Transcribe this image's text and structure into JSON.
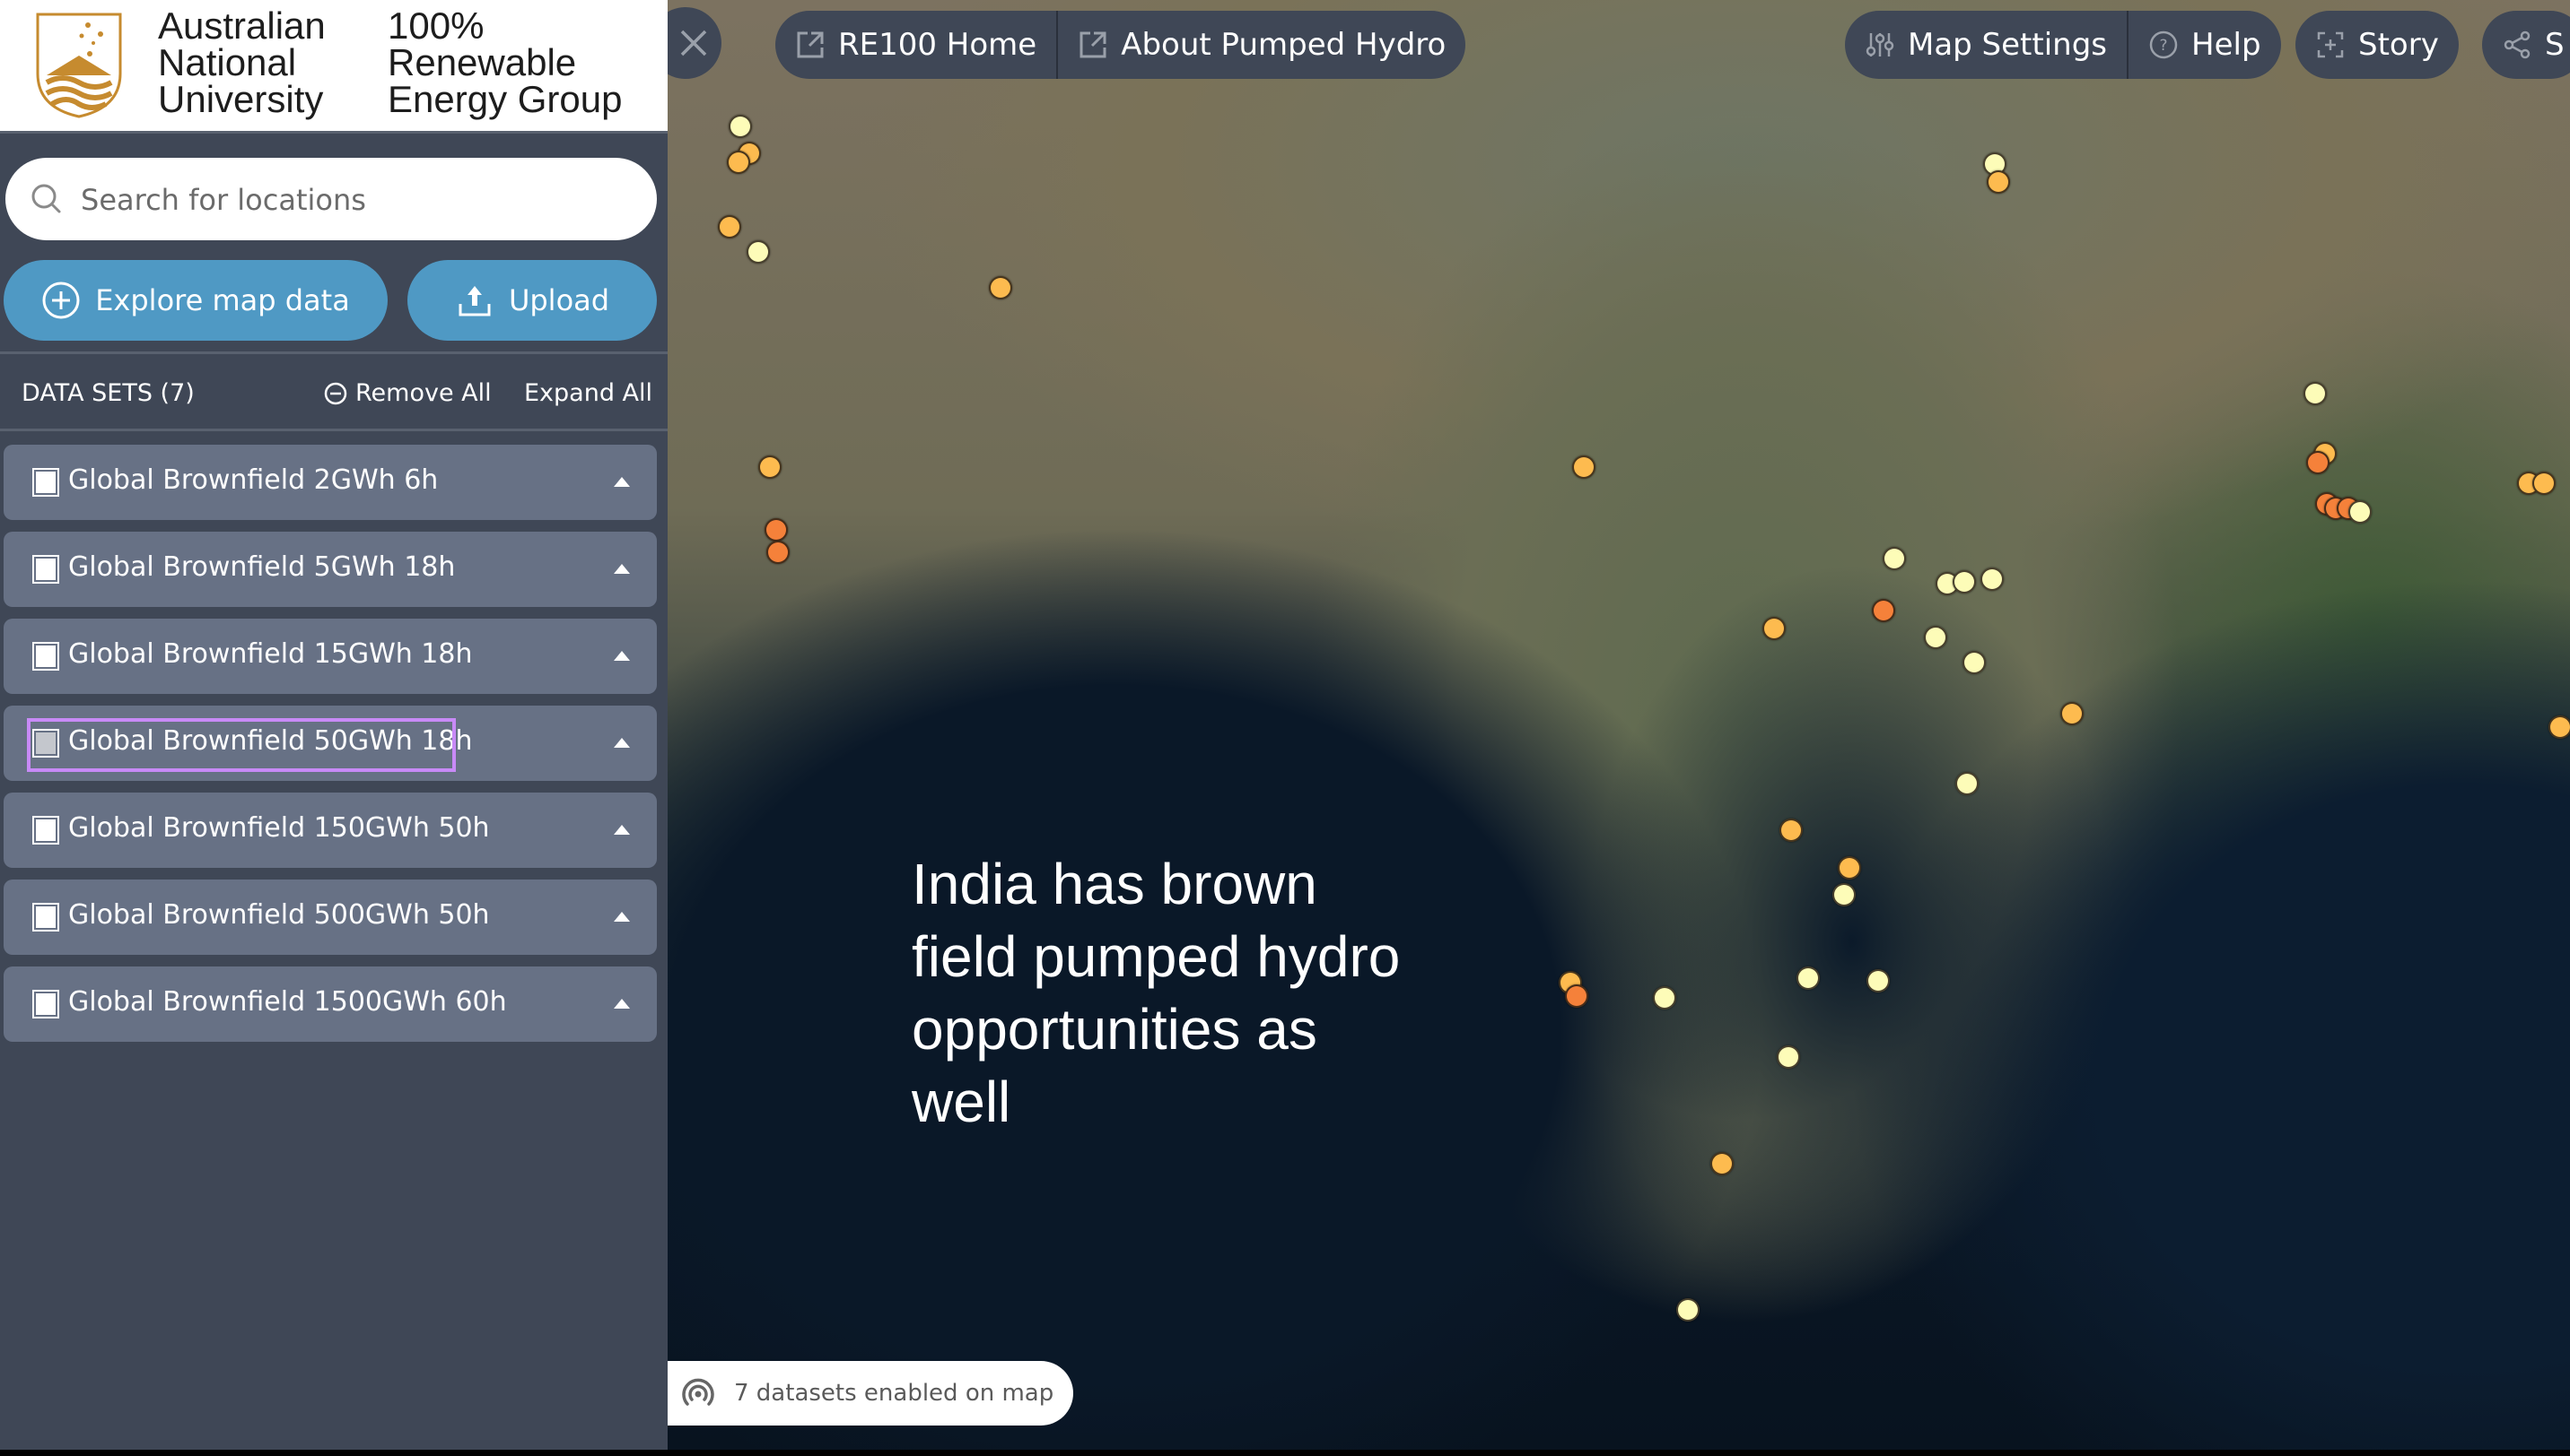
{
  "brand": {
    "university_lines": [
      "Australian",
      "National",
      "University"
    ],
    "group_lines": [
      "100%",
      "Renewable",
      "Energy Group"
    ],
    "crest_color": "#c68b2f"
  },
  "search": {
    "placeholder": "Search for locations",
    "value": ""
  },
  "actions": {
    "explore_label": "Explore map data",
    "upload_label": "Upload",
    "button_color": "#4f99c4"
  },
  "datasets": {
    "title": "DATA SETS (7)",
    "remove_all_label": "Remove All",
    "expand_all_label": "Expand All",
    "items": [
      {
        "label": "Global Brownfield 2GWh 6h",
        "checked": true,
        "focused": false
      },
      {
        "label": "Global Brownfield 5GWh 18h",
        "checked": true,
        "focused": false
      },
      {
        "label": "Global Brownfield 15GWh 18h",
        "checked": true,
        "focused": false
      },
      {
        "label": "Global Brownfield 50GWh 18h",
        "checked": true,
        "focused": true
      },
      {
        "label": "Global Brownfield 150GWh 50h",
        "checked": true,
        "focused": false
      },
      {
        "label": "Global Brownfield 500GWh 50h",
        "checked": true,
        "focused": false
      },
      {
        "label": "Global Brownfield 1500GWh 60h",
        "checked": true,
        "focused": false
      }
    ]
  },
  "nav": {
    "close_label": "Close sidebar",
    "re100_home_label": "RE100 Home",
    "about_label": "About Pumped Hydro",
    "map_settings_label": "Map Settings",
    "help_label": "Help",
    "story_label": "Story",
    "share_label": "S"
  },
  "map": {
    "caption": "India has brown field pumped hydro opportunities as well",
    "status_text": "7 datasets enabled on map",
    "marker_colors": {
      "pale": "#fdfcb8",
      "amber": "#fdbb4f",
      "orange": "#f5813a"
    }
  }
}
